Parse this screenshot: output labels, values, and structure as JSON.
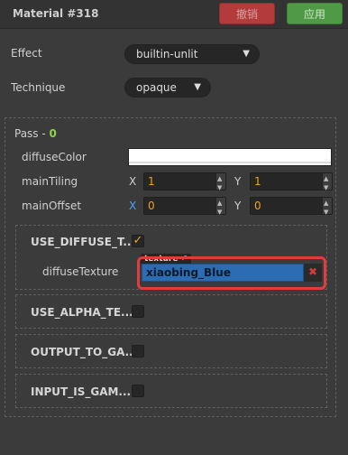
{
  "header": {
    "title": "Material #318",
    "revert_label": "撤销",
    "apply_label": "应用"
  },
  "effect": {
    "label": "Effect",
    "value": "builtin-unlit"
  },
  "technique": {
    "label": "Technique",
    "value": "opaque"
  },
  "pass": {
    "label": "Pass - ",
    "index": "0",
    "diffuse_color": {
      "label": "diffuseColor",
      "color": "#ffffff"
    },
    "main_tiling": {
      "label": "mainTiling",
      "x_label": "X",
      "x": "1",
      "y_label": "Y",
      "y": "1"
    },
    "main_offset": {
      "label": "mainOffset",
      "x_label": "X",
      "x": "0",
      "y_label": "Y",
      "y": "0"
    }
  },
  "defines": [
    {
      "label": "USE_DIFFUSE_T...",
      "checked": true
    },
    {
      "label": "USE_ALPHA_TE...",
      "checked": false
    },
    {
      "label": "OUTPUT_TO_GA...",
      "checked": false
    },
    {
      "label": "INPUT_IS_GAM...",
      "checked": false
    }
  ],
  "diffuse_texture": {
    "label": "diffuseTexture",
    "tag": "texture",
    "value": "xiaobing_Blue",
    "clear_glyph": "✖"
  },
  "colors": {
    "accent_orange": "#f0a020",
    "pass_green": "#8fd14f",
    "highlight_red": "#e03c3c",
    "texture_blue": "#2b6cb3"
  }
}
